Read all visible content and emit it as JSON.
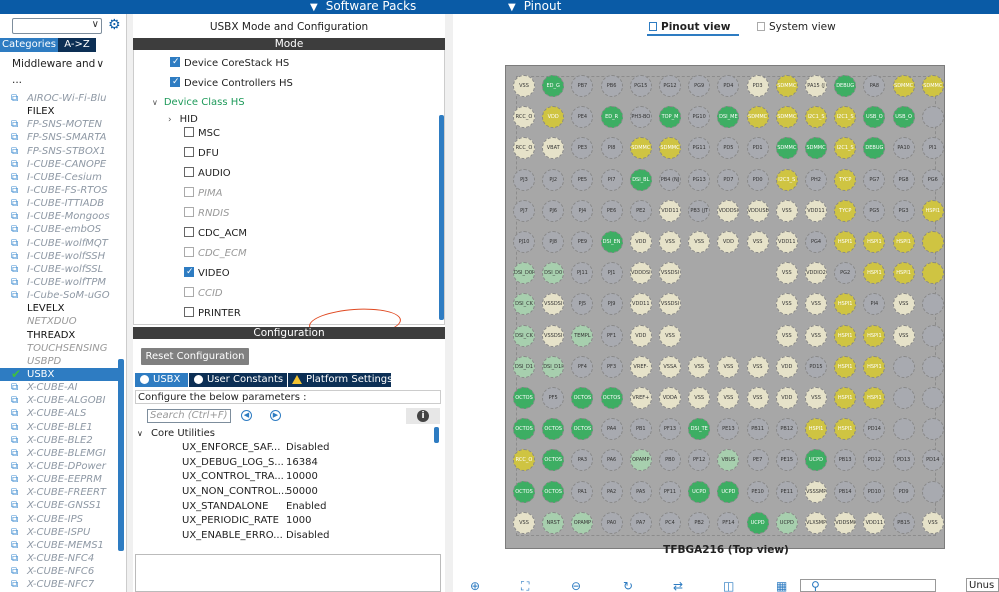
{
  "topbar": {
    "software_packs": "Software Packs",
    "pinout": "Pinout"
  },
  "left": {
    "tabs": [
      "Categories",
      "A->Z"
    ],
    "category_select": "Middleware and ...",
    "items": [
      {
        "label": "AIROC-Wi-Fi-Blu",
        "kind": "pack"
      },
      {
        "label": "FILEX",
        "kind": "plain"
      },
      {
        "label": "FP-SNS-MOTEN",
        "kind": "pack"
      },
      {
        "label": "FP-SNS-SMARTA",
        "kind": "pack"
      },
      {
        "label": "FP-SNS-STBOX1",
        "kind": "pack"
      },
      {
        "label": "I-CUBE-CANOPE",
        "kind": "pack"
      },
      {
        "label": "I-CUBE-Cesium",
        "kind": "pack"
      },
      {
        "label": "I-CUBE-FS-RTOS",
        "kind": "pack"
      },
      {
        "label": "I-CUBE-ITTIADB",
        "kind": "pack"
      },
      {
        "label": "I-CUBE-Mongoos",
        "kind": "pack"
      },
      {
        "label": "I-CUBE-embOS",
        "kind": "pack"
      },
      {
        "label": "I-CUBE-wolfMQT",
        "kind": "pack"
      },
      {
        "label": "I-CUBE-wolfSSH",
        "kind": "pack"
      },
      {
        "label": "I-CUBE-wolfSSL",
        "kind": "pack"
      },
      {
        "label": "I-CUBE-wolfTPM",
        "kind": "pack"
      },
      {
        "label": "I-Cube-SoM-uGO",
        "kind": "pack"
      },
      {
        "label": "LEVELX",
        "kind": "plain"
      },
      {
        "label": "NETXDUO",
        "kind": "grey"
      },
      {
        "label": "THREADX",
        "kind": "plain"
      },
      {
        "label": "TOUCHSENSING",
        "kind": "grey"
      },
      {
        "label": "USBPD",
        "kind": "grey"
      },
      {
        "label": "USBX",
        "kind": "selected"
      },
      {
        "label": "X-CUBE-AI",
        "kind": "pack"
      },
      {
        "label": "X-CUBE-ALGOBI",
        "kind": "pack"
      },
      {
        "label": "X-CUBE-ALS",
        "kind": "pack"
      },
      {
        "label": "X-CUBE-BLE1",
        "kind": "pack"
      },
      {
        "label": "X-CUBE-BLE2",
        "kind": "pack"
      },
      {
        "label": "X-CUBE-BLEMGI",
        "kind": "pack"
      },
      {
        "label": "X-CUBE-DPower",
        "kind": "pack"
      },
      {
        "label": "X-CUBE-EEPRM",
        "kind": "pack"
      },
      {
        "label": "X-CUBE-FREERT",
        "kind": "pack"
      },
      {
        "label": "X-CUBE-GNSS1",
        "kind": "pack"
      },
      {
        "label": "X-CUBE-IPS",
        "kind": "pack"
      },
      {
        "label": "X-CUBE-ISPU",
        "kind": "pack"
      },
      {
        "label": "X-CUBE-MEMS1",
        "kind": "pack"
      },
      {
        "label": "X-CUBE-NFC4",
        "kind": "pack"
      },
      {
        "label": "X-CUBE-NFC6",
        "kind": "pack"
      },
      {
        "label": "X-CUBE-NFC7",
        "kind": "pack"
      }
    ]
  },
  "middle": {
    "title": "USBX Mode and Configuration",
    "mode_band": "Mode",
    "mode": {
      "device_corestack": "Device CoreStack HS",
      "device_controllers": "Device Controllers HS",
      "device_class": "Device Class HS",
      "hid": "HID",
      "classes": [
        {
          "label": "MSC",
          "checked": false,
          "disabled": false
        },
        {
          "label": "DFU",
          "checked": false,
          "disabled": false
        },
        {
          "label": "AUDIO",
          "checked": false,
          "disabled": false
        },
        {
          "label": "PIMA",
          "checked": false,
          "disabled": true
        },
        {
          "label": "RNDIS",
          "checked": false,
          "disabled": true
        },
        {
          "label": "CDC_ACM",
          "checked": false,
          "disabled": false
        },
        {
          "label": "CDC_ECM",
          "checked": false,
          "disabled": true
        },
        {
          "label": "VIDEO",
          "checked": true,
          "disabled": false
        },
        {
          "label": "CCID",
          "checked": false,
          "disabled": true
        },
        {
          "label": "PRINTER",
          "checked": false,
          "disabled": false
        }
      ]
    },
    "config_band": "Configuration",
    "reset_button": "Reset Configuration",
    "config_tabs": [
      "USBX",
      "User Constants",
      "Platform Settings"
    ],
    "params_label": "Configure the below parameters :",
    "search_placeholder": "Search (Ctrl+F)",
    "tree_head": "Core Utilities",
    "params": [
      {
        "key": "UX_ENFORCE_SAF...",
        "value": "Disabled"
      },
      {
        "key": "UX_DEBUG_LOG_S...",
        "value": "16384"
      },
      {
        "key": "UX_CONTROL_TRA...",
        "value": "10000"
      },
      {
        "key": "UX_NON_CONTROL...",
        "value": "50000"
      },
      {
        "key": "UX_STANDALONE",
        "value": "Enabled"
      },
      {
        "key": "UX_PERIODIC_RATE",
        "value": "1000"
      },
      {
        "key": "UX_ENABLE_ERRO...",
        "value": "Disabled"
      }
    ]
  },
  "right": {
    "tab_pinout": "Pinout view",
    "tab_system": "System view",
    "chip_label": "TFBGA216 (Top view)",
    "unused_label": "Unus",
    "pins": [
      [
        "VSS",
        "ED_G",
        "PB7",
        "PB6",
        "PG15",
        "PG12",
        "PG9",
        "PD4",
        "PD3",
        "SDMMC",
        "PA15 (J",
        "DEBUG",
        "PA8",
        "SDMMC",
        "SDMMC"
      ],
      [
        "RCC_O",
        "VDD",
        "PE4",
        "ED_R",
        "PH3-BO",
        "TOP_M",
        "PG10",
        "DSI_ME",
        "SDMMC",
        "SDMMC",
        "I2C1_S",
        "I2C1_S",
        "USB_O",
        "USB_O",
        ""
      ],
      [
        "RCC_O",
        "VBAT",
        "PE3",
        "PI8",
        "SDMMC",
        "SDMMC",
        "PG11",
        "PD5",
        "PD1",
        "SDMMC",
        "SDMMC",
        "I2C1_S",
        "DEBUG",
        "PA10",
        "PI1"
      ],
      [
        "PJ3",
        "PJ2",
        "PE5",
        "PI7",
        "DSI_BL",
        "PB4 (NJ",
        "PG13",
        "PD7",
        "PD0",
        "I2C3_S",
        "PH2",
        "TYCP",
        "PG7",
        "PG8",
        "PG6"
      ],
      [
        "PJ7",
        "PJ6",
        "PJ4",
        "PE6",
        "PE2",
        "VDD11",
        "PB3 (JT",
        "VDDDSI",
        "VDDUSB",
        "VSS",
        "VDD11",
        "TYCP",
        "PG5",
        "PG3",
        "HSPI1"
      ],
      [
        "PJ10",
        "PJ8",
        "PE9",
        "DSI_EN",
        "VDD",
        "VSS",
        "VSS",
        "VDD",
        "VSS",
        "VDD11",
        "PG4",
        "HSPI1",
        "HSPI1",
        "HSPI1",
        ""
      ],
      [
        "DSI_D0P",
        "DSI_D0",
        "PJ11",
        "PJ1",
        "VDDDSI",
        "VSSDSI",
        "",
        "",
        "",
        "VSS",
        "VDDIO2",
        "PG2",
        "HSPI1",
        "HSPI1",
        ""
      ],
      [
        "DSI_CK",
        "VSSDSI",
        "PJ5",
        "PJ9",
        "VDD11",
        "VSSDSI",
        "",
        "",
        "",
        "VSS",
        "VSS",
        "HSPI1",
        "PI4",
        "VSS",
        ""
      ],
      [
        "DSI_CK",
        "VSSDSI",
        "TEMPL",
        "PF1",
        "VDD",
        "VSS",
        "",
        "",
        "",
        "VSS",
        "VSS",
        "HSPI1",
        "HSPI1",
        "VSS",
        ""
      ],
      [
        "DSI_D1",
        "DSI_D1P",
        "PF4",
        "PF3",
        "VREF-",
        "VSSA",
        "VSS",
        "VSS",
        "VSS",
        "VDD",
        "PD15",
        "HSPI1",
        "HSPI1",
        "",
        ""
      ],
      [
        "OCTOS",
        "PF5",
        "OCTOS",
        "OCTOS",
        "VREF+",
        "VDDA",
        "VSS",
        "VSS",
        "VSS",
        "VDD",
        "VSS",
        "HSPI1",
        "HSPI1",
        "",
        ""
      ],
      [
        "OCTOS",
        "OCTOS",
        "OCTOS",
        "PA4",
        "PB1",
        "PF13",
        "DSI_TE",
        "PE13",
        "PB11",
        "PB12",
        "HSPI1",
        "HSPI1",
        "PD14",
        "",
        ""
      ],
      [
        "RCC_O",
        "OCTOS",
        "PA3",
        "PA6",
        "OPAMP",
        "PB0",
        "PF12",
        "VBUS",
        "PE7",
        "PE15",
        "UCPD",
        "PB13",
        "PD12",
        "PD13",
        "PD14"
      ],
      [
        "OCTOS",
        "OCTOS",
        "PA1",
        "PA2",
        "PA5",
        "PF11",
        "UCPD",
        "UCPD",
        "PE10",
        "PE11",
        "VSSSMPS",
        "PB14",
        "PD10",
        "PD9",
        ""
      ],
      [
        "VSS",
        "NRST",
        "OPAMP",
        "PA0",
        "PA7",
        "PC4",
        "PB2",
        "PF14",
        "UCPD",
        "UCPD",
        "VLXSMPS",
        "VDDSMPS",
        "VDD11",
        "PB15",
        "VSS"
      ]
    ],
    "pin_colors": [
      [
        "p",
        "G",
        "g",
        "g",
        "g",
        "g",
        "g",
        "g",
        "p",
        "Y",
        "p",
        "G",
        "g",
        "Y",
        "Y"
      ],
      [
        "p",
        "Y",
        "g",
        "G",
        "g",
        "G",
        "g",
        "G",
        "Y",
        "Y",
        "Y",
        "Y",
        "G",
        "G",
        "g"
      ],
      [
        "p",
        "p",
        "g",
        "g",
        "Y",
        "Y",
        "g",
        "g",
        "g",
        "G",
        "G",
        "Y",
        "G",
        "g",
        "g"
      ],
      [
        "g",
        "g",
        "g",
        "g",
        "G",
        "g",
        "g",
        "g",
        "g",
        "Y",
        "g",
        "Y",
        "g",
        "g",
        "g"
      ],
      [
        "g",
        "g",
        "g",
        "g",
        "g",
        "p",
        "g",
        "p",
        "p",
        "p",
        "p",
        "Y",
        "g",
        "g",
        "Y"
      ],
      [
        "g",
        "g",
        "g",
        "G",
        "p",
        "p",
        "p",
        "p",
        "p",
        "p",
        "g",
        "Y",
        "Y",
        "Y",
        "Y"
      ],
      [
        "L",
        "L",
        "g",
        "g",
        "p",
        "p",
        "",
        "",
        "",
        "p",
        "p",
        "g",
        "Y",
        "Y",
        "Y"
      ],
      [
        "L",
        "p",
        "g",
        "g",
        "p",
        "p",
        "",
        "",
        "",
        "p",
        "p",
        "Y",
        "g",
        "p",
        "g"
      ],
      [
        "L",
        "p",
        "L",
        "g",
        "p",
        "p",
        "",
        "",
        "",
        "p",
        "p",
        "Y",
        "Y",
        "p",
        "g"
      ],
      [
        "L",
        "L",
        "g",
        "g",
        "p",
        "p",
        "p",
        "p",
        "p",
        "p",
        "g",
        "Y",
        "Y",
        "g",
        "g"
      ],
      [
        "G",
        "g",
        "G",
        "G",
        "p",
        "p",
        "p",
        "p",
        "p",
        "p",
        "p",
        "Y",
        "Y",
        "g",
        "g"
      ],
      [
        "G",
        "G",
        "G",
        "g",
        "g",
        "g",
        "G",
        "g",
        "g",
        "g",
        "Y",
        "Y",
        "g",
        "g",
        "g"
      ],
      [
        "Y",
        "G",
        "g",
        "g",
        "L",
        "g",
        "g",
        "L",
        "g",
        "g",
        "G",
        "g",
        "g",
        "g",
        "g"
      ],
      [
        "G",
        "G",
        "g",
        "g",
        "g",
        "g",
        "G",
        "G",
        "g",
        "g",
        "p",
        "g",
        "g",
        "g",
        "g"
      ],
      [
        "p",
        "L",
        "L",
        "g",
        "g",
        "g",
        "g",
        "g",
        "G",
        "L",
        "p",
        "p",
        "p",
        "g",
        "p"
      ]
    ]
  }
}
